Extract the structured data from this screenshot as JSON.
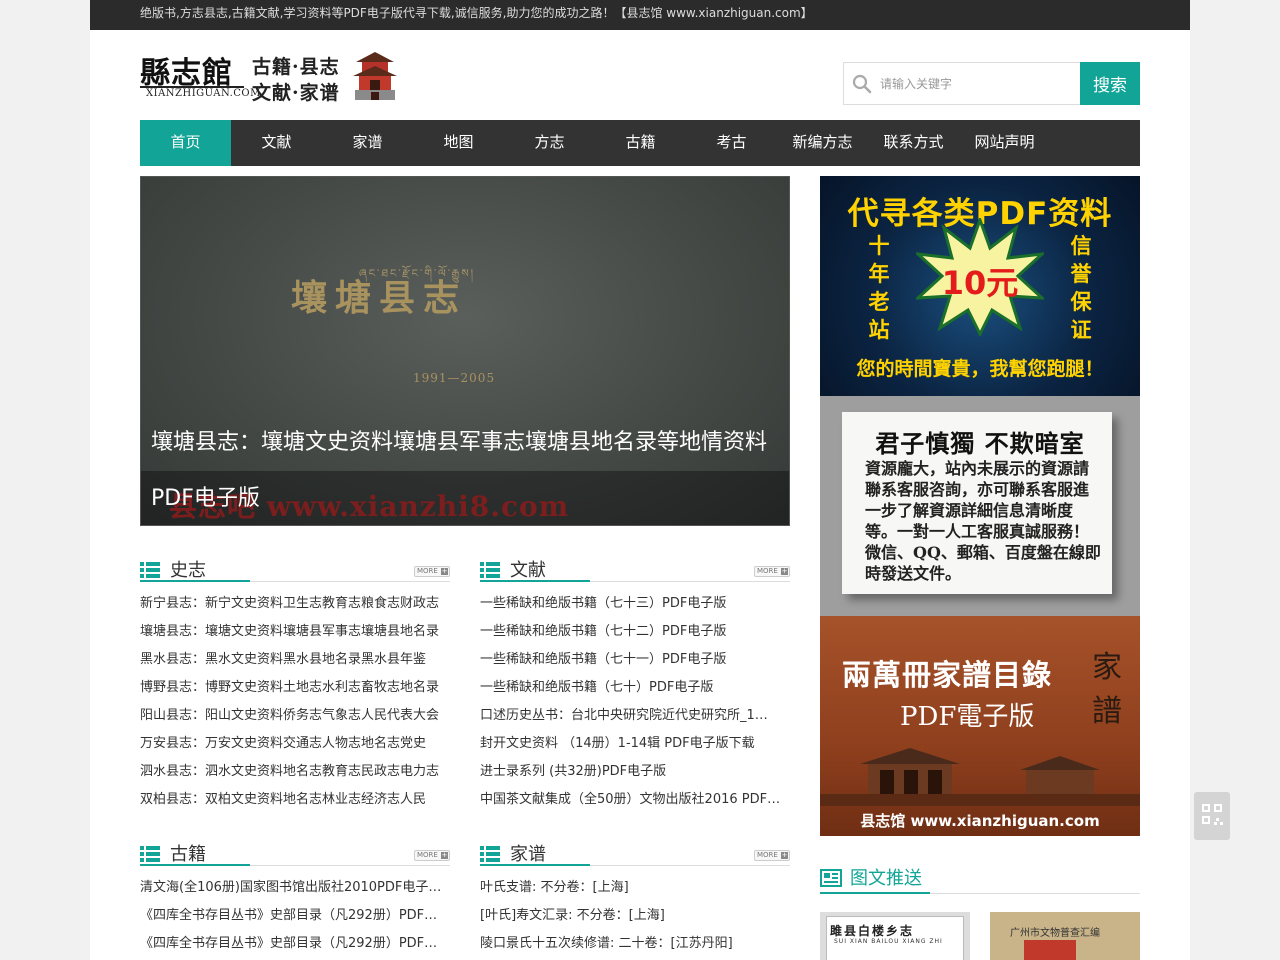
{
  "topbar": {
    "text": "绝版书,方志县志,古籍文献,学习资料等PDF电子版代寻下载,诚信服务,助力您的成功之路！【县志馆 www.xianzhiguan.com】"
  },
  "logo": {
    "name": "縣志館",
    "domain": "XIANZHIGUAN.COM",
    "tag1": "古籍·县志",
    "tag2": "文献·家谱"
  },
  "search": {
    "placeholder": "请输入关键字",
    "button": "搜索"
  },
  "nav": {
    "items": [
      "首页",
      "文献",
      "家谱",
      "地图",
      "方志",
      "古籍",
      "考古",
      "新编方志",
      "联系方式",
      "网站声明"
    ],
    "active": 0
  },
  "slide": {
    "caption": "壤塘县志：壤塘文史资料壤塘县军事志壤塘县地名录等地情资料PDF电子版",
    "book_title": "壤塘县志",
    "book_years": "1991—2005",
    "tibetan": "ཞང་ཐང་རྫོང་གི་ལོ་རྒྱུས།",
    "watermark": "县志吧 www.xianzhi8.com"
  },
  "sections": {
    "more_label": "MORE",
    "shizhi": {
      "title": "史志",
      "items": [
        "新宁县志：新宁文史资料卫生志教育志粮食志财政志",
        "壤塘县志：壤塘文史资料壤塘县军事志壤塘县地名录",
        "黑水县志：黑水文史资料黑水县地名录黑水县年鉴",
        "博野县志：博野文史资料土地志水利志畜牧志地名录",
        "阳山县志：阳山文史资料侨务志气象志人民代表大会",
        "万安县志：万安文史资料交通志人物志地名志党史",
        "泗水县志：泗水文史资料地名志教育志民政志电力志",
        "双柏县志：双柏文史资料地名志林业志经济志人民"
      ]
    },
    "wenxian": {
      "title": "文献",
      "items": [
        "一些稀缺和绝版书籍（七十三）PDF电子版",
        "一些稀缺和绝版书籍（七十二）PDF电子版",
        "一些稀缺和绝版书籍（七十一）PDF电子版",
        "一些稀缺和绝版书籍（七十）PDF电子版",
        "口述历史丛书：台北中央研究院近代史研究所_1…",
        "封开文史资料 （14册）1-14辑 PDF电子版下载",
        "进士录系列 (共32册)PDF电子版",
        "中国茶文献集成（全50册）文物出版社2016 PDF…"
      ]
    },
    "guji": {
      "title": "古籍",
      "items": [
        "清文海(全106册)国家图书馆出版社2010PDF电子…",
        "《四库全书存目丛书》史部目录（凡292册）PDF…",
        "《四库全书存目丛书》史部目录（凡292册）PDF…"
      ]
    },
    "jiapu": {
      "title": "家谱",
      "items": [
        "叶氏支谱: 不分卷：[上海]",
        "[叶氏]寿文汇录: 不分卷：[上海]",
        "陵口景氏十五次续修谱: 二十卷：[江苏丹阳]"
      ]
    }
  },
  "ads": {
    "ad1": {
      "headline": "代寻各类PDF资料",
      "left": "十年老站",
      "right": "信誉保证",
      "price": "10元",
      "footer": "您的時間寶貴，我幫您跑腿！"
    },
    "ad2": {
      "headline": "君子慎獨 不欺暗室",
      "body": "資源龐大，站內未展示的資源請聯系客服咨詢，亦可聯系客服進一步了解資源詳細信息清晰度等。一對一人工客服真誠服務！微信、QQ、郵箱、百度盤在線即時發送文件。"
    },
    "ad3": {
      "headline": "兩萬冊家譜目錄",
      "sub": "PDF電子版",
      "vertical": "家譜",
      "footer": "县志馆 www.xianzhiguan.com"
    }
  },
  "tuwen": {
    "title": "图文推送",
    "thumb1_title": "雎县白楼乡志",
    "thumb1_sub": "SUI XIAN BAILOU XIANG ZHI",
    "thumb2_title": "广州市文物普查汇编"
  },
  "colors": {
    "accent": "#12a597",
    "nav_bg": "#333333",
    "topbar_bg": "#2b2b2b"
  }
}
